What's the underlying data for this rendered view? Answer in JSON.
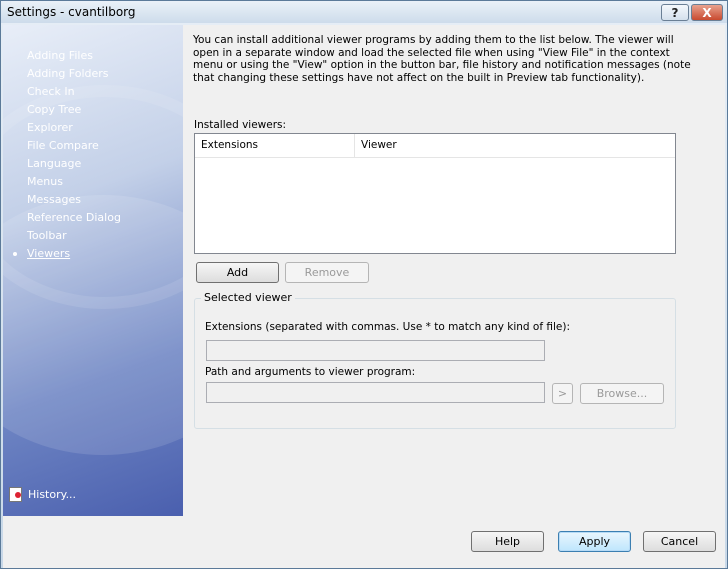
{
  "window": {
    "title": "Settings - cvantilborg",
    "help_glyph": "?",
    "close_glyph": "X"
  },
  "sidebar": {
    "items": [
      {
        "label": "Adding Files"
      },
      {
        "label": "Adding Folders"
      },
      {
        "label": "Check In"
      },
      {
        "label": "Copy Tree"
      },
      {
        "label": "Explorer"
      },
      {
        "label": "File Compare"
      },
      {
        "label": "Language"
      },
      {
        "label": "Menus"
      },
      {
        "label": "Messages"
      },
      {
        "label": "Reference Dialog"
      },
      {
        "label": "Toolbar"
      },
      {
        "label": "Viewers",
        "active": true
      }
    ],
    "history_label": "History..."
  },
  "main": {
    "description": "You can install additional viewer programs by adding them to the list below. The viewer will open in a separate window and load the selected file when using \"View File\" in the context menu or using the \"View\" option in the button bar, file history and notification messages (note that changing these settings have not affect on the built in Preview tab functionality).",
    "installed_label": "Installed viewers:",
    "columns": [
      "Extensions",
      "Viewer"
    ],
    "rows": [],
    "add_label": "Add",
    "remove_label": "Remove",
    "selected_group": {
      "title": "Selected viewer",
      "extensions_label": "Extensions (separated with commas. Use * to match any kind of file):",
      "extensions_value": "",
      "path_label": "Path and arguments to viewer program:",
      "path_value": "",
      "arrow_label": ">",
      "browse_label": "Browse..."
    }
  },
  "footer": {
    "help_label": "Help",
    "apply_label": "Apply",
    "cancel_label": "Cancel"
  }
}
